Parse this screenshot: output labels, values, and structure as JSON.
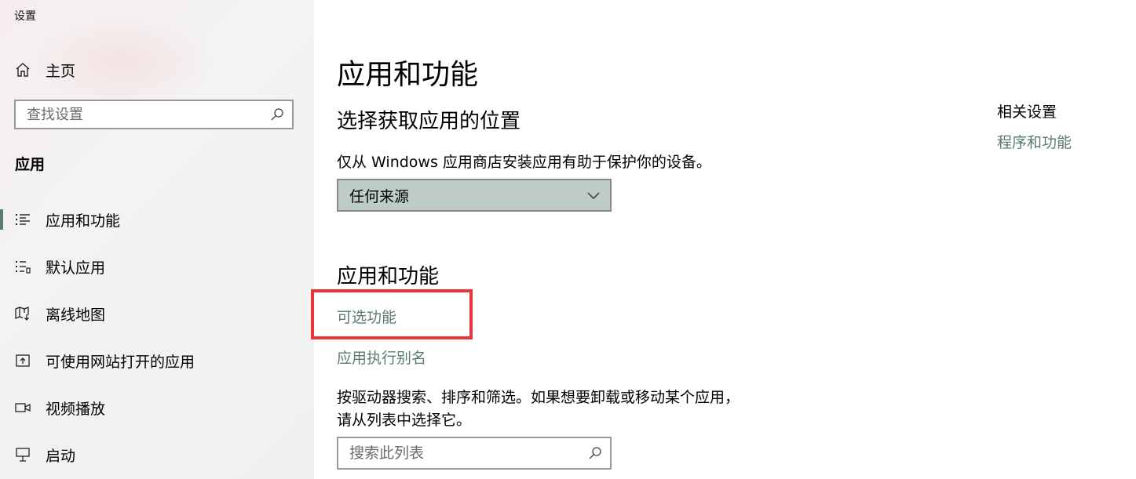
{
  "window": {
    "title": "设置"
  },
  "sidebar": {
    "home_label": "主页",
    "search_placeholder": "查找设置",
    "section_heading": "应用",
    "items": [
      {
        "label": "应用和功能",
        "icon": "apps-list-icon",
        "active": true
      },
      {
        "label": "默认应用",
        "icon": "default-apps-icon",
        "active": false
      },
      {
        "label": "离线地图",
        "icon": "offline-map-icon",
        "active": false
      },
      {
        "label": "可使用网站打开的应用",
        "icon": "website-apps-icon",
        "active": false
      },
      {
        "label": "视频播放",
        "icon": "video-playback-icon",
        "active": false
      },
      {
        "label": "启动",
        "icon": "startup-icon",
        "active": false
      }
    ]
  },
  "main": {
    "title": "应用和功能",
    "source_section": {
      "heading": "选择获取应用的位置",
      "description": "仅从 Windows 应用商店安装应用有助于保护你的设备。",
      "dropdown_value": "任何来源"
    },
    "apps_section": {
      "heading": "应用和功能",
      "optional_features_link": "可选功能",
      "aliases_link": "应用执行别名",
      "description_line1": "按驱动器搜索、排序和筛选。如果想要卸载或移动某个应用，",
      "description_line2": "请从列表中选择它。",
      "search_placeholder": "搜索此列表"
    }
  },
  "related": {
    "heading": "相关设置",
    "link": "程序和功能"
  },
  "colors": {
    "accent": "#5a7a72",
    "highlight": "#e8353b",
    "dropdown_bg": "#bfcbc7"
  }
}
